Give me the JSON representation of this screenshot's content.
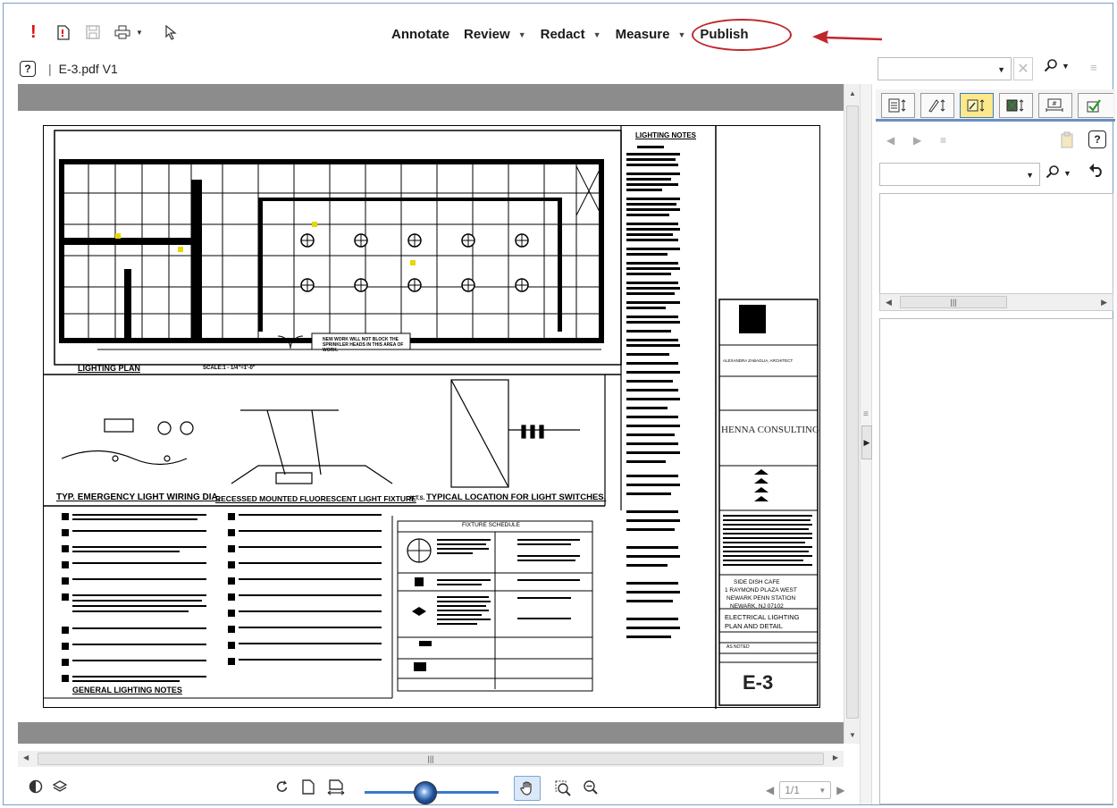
{
  "toolbar": {
    "icons": [
      "alert-icon",
      "new-doc-icon",
      "save-icon",
      "print-icon",
      "select-arrow-icon"
    ],
    "menus": [
      {
        "label": "Annotate",
        "dropdown": false
      },
      {
        "label": "Review",
        "dropdown": true
      },
      {
        "label": "Redact",
        "dropdown": true
      },
      {
        "label": "Measure",
        "dropdown": true
      },
      {
        "label": "Publish",
        "dropdown": false
      }
    ],
    "highlight_color": "#c0272d"
  },
  "document": {
    "title": "E-3.pdf V1"
  },
  "drawing": {
    "lighting_notes_title": "LIGHTING NOTES",
    "lighting_plan_title": "LIGHTING PLAN",
    "scale": "SCALE:1 - 1/4\"=1'-0\"",
    "plan_note": "NEW WORK WILL NOT BLOCK THE SPRINKLER HEADS IN THIS AREA OF WORK.",
    "detail_1": "TYP. EMERGENCY LIGHT WIRING DIA.",
    "detail_2": "RECESSED MOUNTED FLUORESCENT LIGHT FIXTURE",
    "detail_2_scale": "N.T.S.",
    "detail_3": "TYPICAL LOCATION FOR LIGHT SWITCHES.",
    "general_notes_title": "GENERAL LIGHTING NOTES",
    "fixture_schedule_title": "FIXTURE SCHEDULE",
    "company": "HENNA CONSULTING",
    "architect": "ALEXANDRA ZABAGLIA, ARCHITECT",
    "project_name": "SIDE DISH CAFE",
    "address_1": "1 RAYMOND PLAZA WEST",
    "address_2": "NEWARK PENN STATION",
    "address_3": "NEWARK, NJ 07102",
    "sheet_title_1": "ELECTRICAL LIGHTING",
    "sheet_title_2": "PLAN AND DETAIL",
    "scale_value": "AS NOTED",
    "sheet_number": "E-3"
  },
  "zoom": {
    "level": 0.45
  },
  "pagination": {
    "current": "1/1"
  },
  "right_panel": {
    "tabs": [
      "thumbnails-tab",
      "markup-tab",
      "annotation-tab",
      "redact-tab",
      "measure-tab",
      "checkmark-tab"
    ],
    "active_tab_index": 2
  }
}
